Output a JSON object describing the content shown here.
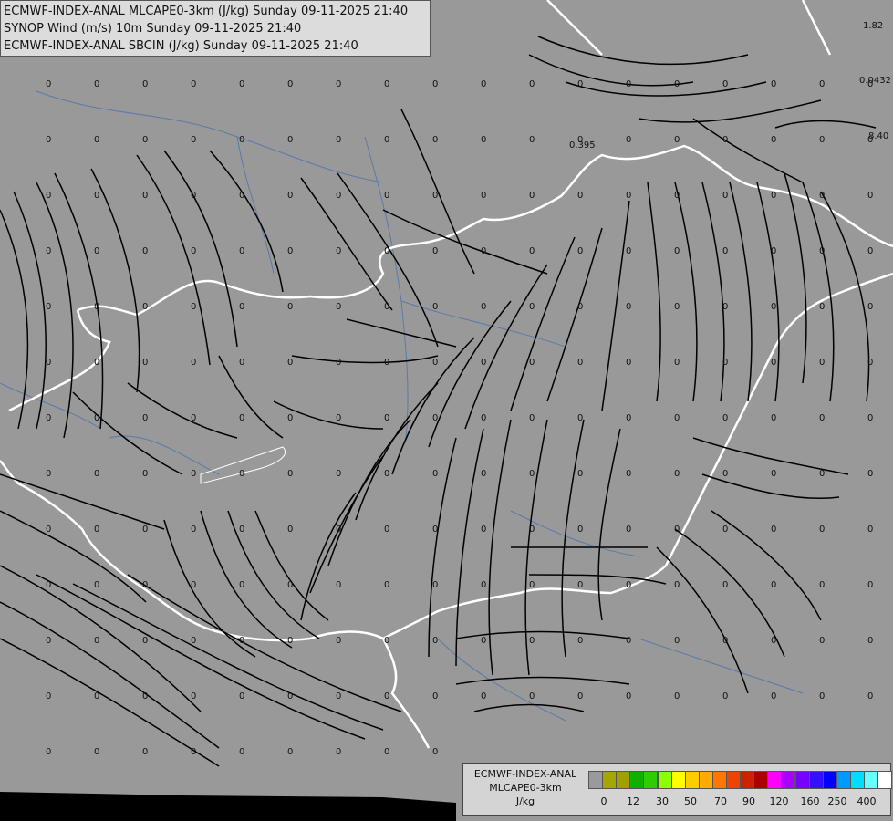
{
  "titles": [
    "ECMWF-INDEX-ANAL MLCAPE0-3km (J/kg) Sunday 09-11-2025 21:40",
    "SYNOP Wind (m/s) 10m Sunday 09-11-2025 21:40",
    "ECMWF-INDEX-ANAL SBCIN (J/kg) Sunday 09-11-2025 21:40"
  ],
  "field_values": {
    "all_grid_points": "0",
    "extra": [
      "1.82",
      "0.0432",
      "0.395",
      "8.40"
    ]
  },
  "legend": {
    "title_line1": "ECMWF-INDEX-ANAL",
    "title_line2": "MLCAPE0-3km",
    "unit": "J/kg",
    "colors": [
      "#9a9a9a",
      "#a6a600",
      "#a0a000",
      "#10b000",
      "#2ecc00",
      "#8cff00",
      "#ffff00",
      "#ffcc00",
      "#ffaa00",
      "#ff7700",
      "#ee4400",
      "#cc2200",
      "#aa0000",
      "#ff00ff",
      "#aa00ff",
      "#7700ff",
      "#3311ff",
      "#0000ff",
      "#0099ff",
      "#00ddff",
      "#66ffff",
      "#ffffff"
    ],
    "ticks": [
      "0",
      "12",
      "30",
      "50",
      "70",
      "90",
      "120",
      "160",
      "250",
      "400"
    ]
  },
  "colors": {
    "background": "#999999",
    "border": "#ffffff",
    "river": "#5577aa",
    "streamline": "#000000"
  }
}
